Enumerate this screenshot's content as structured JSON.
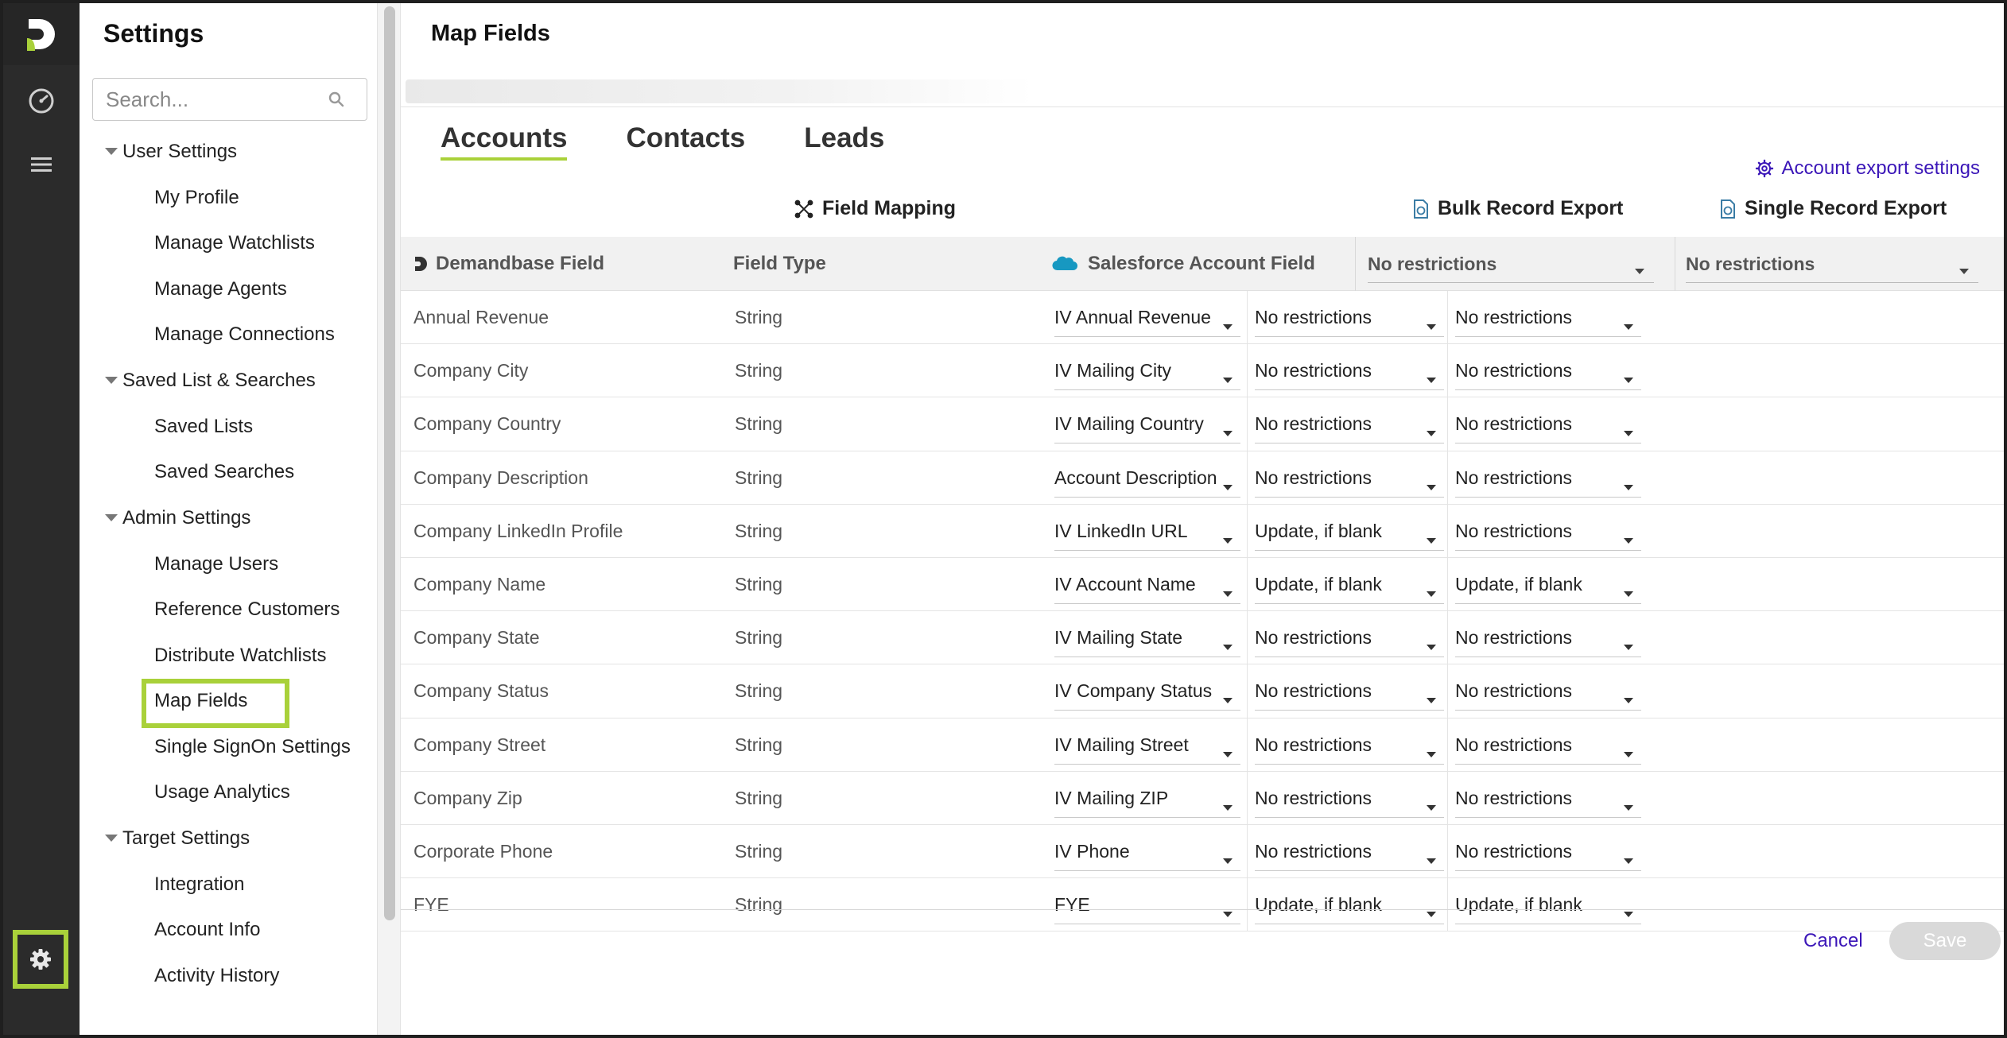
{
  "sidebar": {
    "title": "Settings",
    "search_placeholder": "Search...",
    "groups": [
      {
        "label": "User Settings",
        "items": [
          "My Profile",
          "Manage Watchlists",
          "Manage Agents",
          "Manage Connections"
        ]
      },
      {
        "label": "Saved List & Searches",
        "items": [
          "Saved Lists",
          "Saved Searches"
        ]
      },
      {
        "label": "Admin Settings",
        "items": [
          "Manage Users",
          "Reference Customers",
          "Distribute Watchlists",
          "Map Fields",
          "Single SignOn Settings",
          "Usage Analytics"
        ]
      },
      {
        "label": "Target Settings",
        "items": [
          "Integration",
          "Account Info",
          "Activity History"
        ]
      }
    ],
    "active_item": "Map Fields"
  },
  "main": {
    "title": "Map Fields",
    "tabs": [
      "Accounts",
      "Contacts",
      "Leads"
    ],
    "active_tab": "Accounts",
    "export_settings_label": "Account export settings",
    "sections": {
      "field_mapping": "Field Mapping",
      "bulk_export": "Bulk Record Export",
      "single_export": "Single Record Export"
    },
    "headers": {
      "demandbase_field": "Demandbase Field",
      "field_type": "Field Type",
      "salesforce_field": "Salesforce Account Field",
      "bulk_default": "No restrictions",
      "single_default": "No restrictions"
    },
    "rows": [
      {
        "name": "Annual Revenue",
        "type": "String",
        "sf": "IV Annual Revenue",
        "bulk": "No restrictions",
        "single": "No restrictions"
      },
      {
        "name": "Company City",
        "type": "String",
        "sf": "IV Mailing City",
        "bulk": "No restrictions",
        "single": "No restrictions"
      },
      {
        "name": "Company Country",
        "type": "String",
        "sf": "IV Mailing Country",
        "bulk": "No restrictions",
        "single": "No restrictions"
      },
      {
        "name": "Company Description",
        "type": "String",
        "sf": "Account Description",
        "bulk": "No restrictions",
        "single": "No restrictions"
      },
      {
        "name": "Company LinkedIn Profile",
        "type": "String",
        "sf": "IV LinkedIn URL",
        "bulk": "Update, if blank",
        "single": "No restrictions"
      },
      {
        "name": "Company Name",
        "type": "String",
        "sf": "IV Account Name",
        "bulk": "Update, if blank",
        "single": "Update, if blank"
      },
      {
        "name": "Company State",
        "type": "String",
        "sf": "IV Mailing State",
        "bulk": "No restrictions",
        "single": "No restrictions"
      },
      {
        "name": "Company Status",
        "type": "String",
        "sf": "IV Company Status",
        "bulk": "No restrictions",
        "single": "No restrictions"
      },
      {
        "name": "Company Street",
        "type": "String",
        "sf": "IV Mailing Street",
        "bulk": "No restrictions",
        "single": "No restrictions"
      },
      {
        "name": "Company Zip",
        "type": "String",
        "sf": "IV Mailing ZIP",
        "bulk": "No restrictions",
        "single": "No restrictions"
      },
      {
        "name": "Corporate Phone",
        "type": "String",
        "sf": "IV Phone",
        "bulk": "No restrictions",
        "single": "No restrictions"
      },
      {
        "name": "FYE",
        "type": "String",
        "sf": "FYE",
        "bulk": "Update, if blank",
        "single": "Update, if blank"
      }
    ],
    "cancel_label": "Cancel",
    "save_label": "Save"
  },
  "colors": {
    "accent": "#a9d13a",
    "link": "#3b16b8",
    "rail": "#2b2b2b"
  }
}
